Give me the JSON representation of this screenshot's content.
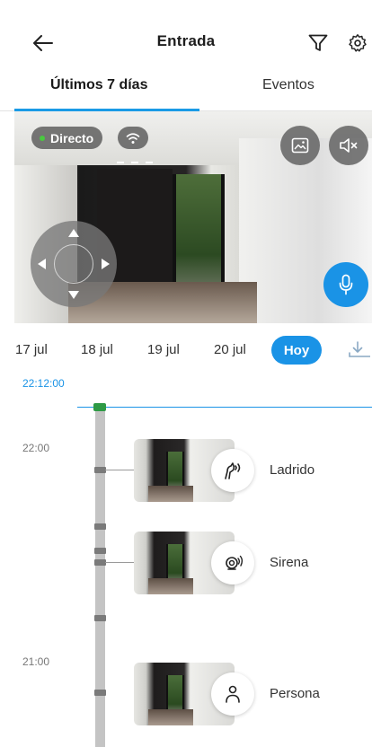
{
  "header": {
    "title": "Entrada"
  },
  "tabs": [
    {
      "label": "Últimos 7 días",
      "active": true
    },
    {
      "label": "Eventos",
      "active": false
    }
  ],
  "video": {
    "live_label": "Directo",
    "live_dot_color": "#49c83f"
  },
  "dates": {
    "items": [
      "17 jul",
      "18 jul",
      "19 jul",
      "20 jul"
    ],
    "today": "Hoy"
  },
  "timeline": {
    "current_time": "22:12:00",
    "hour_labels": [
      "22:00",
      "21:00"
    ],
    "events": [
      {
        "label": "Ladrido",
        "icon": "dog-bark-icon"
      },
      {
        "label": "Sirena",
        "icon": "siren-icon"
      },
      {
        "label": "Persona",
        "icon": "person-icon"
      }
    ]
  },
  "colors": {
    "accent": "#1a93e6",
    "marker": "#2e9a45"
  }
}
